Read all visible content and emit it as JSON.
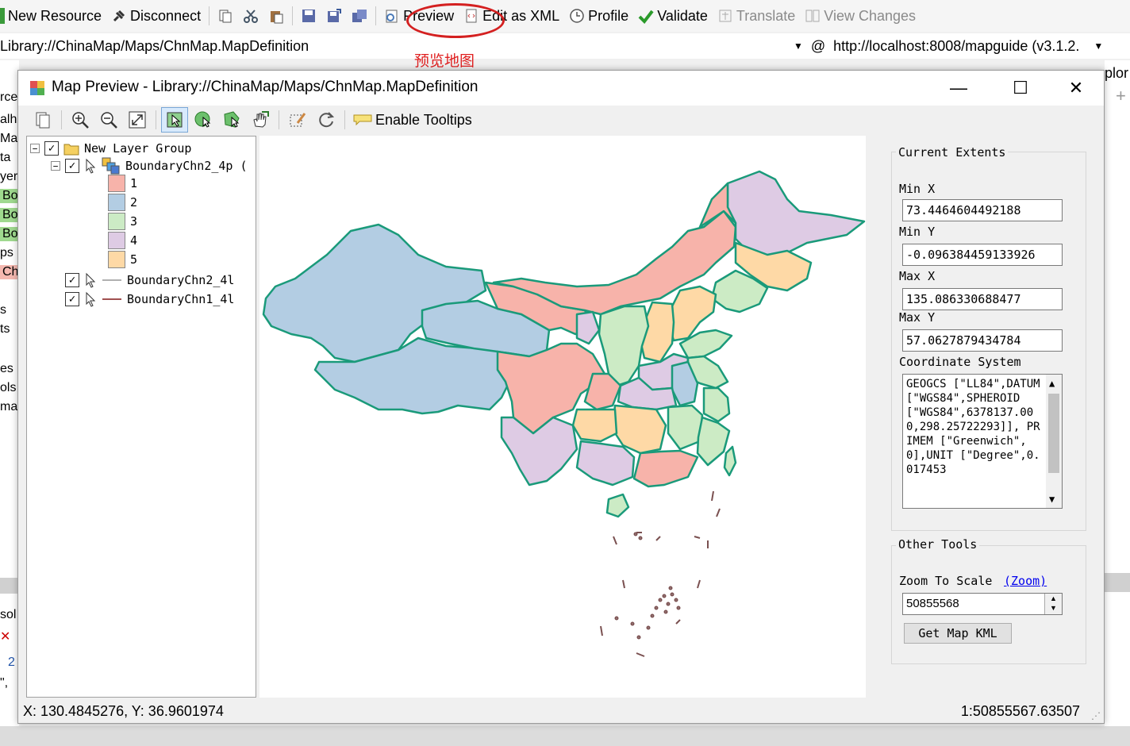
{
  "toolbar": {
    "new_resource": "New Resource",
    "disconnect": "Disconnect",
    "preview": "Preview",
    "edit_xml": "Edit as XML",
    "profile": "Profile",
    "validate": "Validate",
    "translate": "Translate",
    "view_changes": "View Changes"
  },
  "address": {
    "resource": "Library://ChinaMap/Maps/ChnMap.MapDefinition",
    "server": "http://localhost:8008/mapguide (v3.1.2."
  },
  "annotation": "预览地图",
  "background": {
    "left_texts": [
      "rce",
      "alho",
      "Map",
      "ta",
      "yer",
      "Bo",
      "Bo",
      "Bo",
      "ps",
      "Ch",
      "s",
      "ts",
      "es",
      "ols",
      "mar",
      "sol",
      "2",
      "\","
    ],
    "right_text": "plor"
  },
  "window": {
    "title": "Map Preview - Library://ChinaMap/Maps/ChnMap.MapDefinition",
    "minimize": "—",
    "maximize": "☐",
    "close": "✕"
  },
  "map_toolbar": {
    "enable_tooltips": "Enable Tooltips"
  },
  "legend": {
    "group": "New Layer Group",
    "layers": [
      "BoundaryChn2_4p (",
      "BoundaryChn2_4l",
      "BoundaryChn1_4l"
    ],
    "themes": [
      {
        "label": "1",
        "color": "#f7b3aa"
      },
      {
        "label": "2",
        "color": "#b3cde3"
      },
      {
        "label": "3",
        "color": "#ccebc5"
      },
      {
        "label": "4",
        "color": "#decbe4"
      },
      {
        "label": "5",
        "color": "#fed9a6"
      }
    ],
    "line_colors": {
      "chn2": "#b0b0b0",
      "chn1": "#a05050"
    }
  },
  "properties": {
    "current_extents": "Current Extents",
    "min_x_label": "Min X",
    "min_x": "73.4464604492188",
    "min_y_label": "Min Y",
    "min_y": "-0.096384459133926",
    "max_x_label": "Max X",
    "max_x": "135.086330688477",
    "max_y_label": "Max Y",
    "max_y": "57.0627879434784",
    "coord_label": "Coordinate System",
    "coord_text": "GEOGCS [\"LL84\",DATUM [\"WGS84\",SPHEROID [\"WGS84\",6378137.000,298.25722293]], PRIMEM [\"Greenwich\",0],UNIT [\"Degree\",0.017453",
    "other_tools": "Other Tools",
    "zoom_label": "Zoom To Scale",
    "zoom_link": "(Zoom)",
    "zoom_value": "50855568",
    "kml_button": "Get Map KML"
  },
  "status": {
    "coords": "X: 130.4845276, Y: 36.9601974",
    "scale": "1:50855567.63507"
  }
}
